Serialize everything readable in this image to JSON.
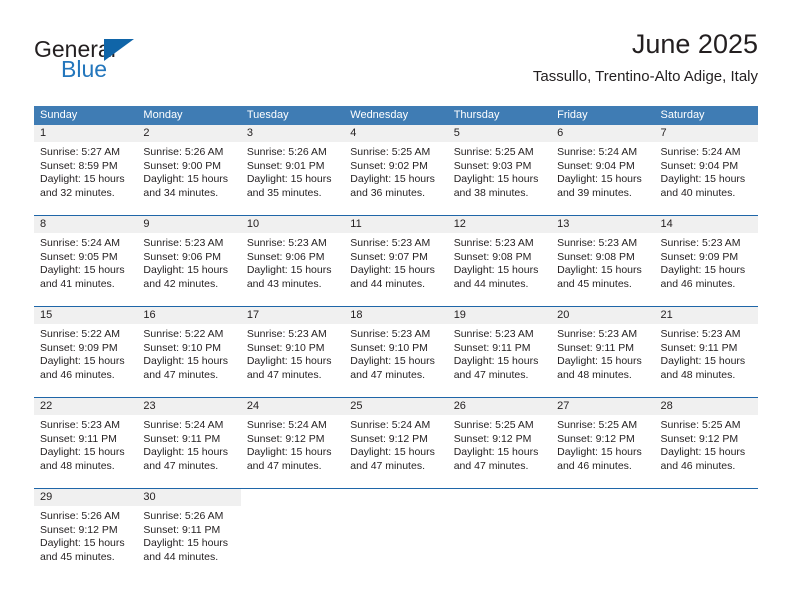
{
  "brand": {
    "name_part1": "General",
    "name_part2": "Blue"
  },
  "header": {
    "month_title": "June 2025",
    "location": "Tassullo, Trentino-Alto Adige, Italy"
  },
  "colors": {
    "header_blue": "#3f7cb4",
    "row_border_blue": "#1f66a8",
    "daynum_band": "#f0f0f0",
    "brand_blue": "#2376bc",
    "text": "#231f20"
  },
  "weekdays": [
    "Sunday",
    "Monday",
    "Tuesday",
    "Wednesday",
    "Thursday",
    "Friday",
    "Saturday"
  ],
  "weeks": [
    [
      {
        "day": "1",
        "sunrise": "Sunrise: 5:27 AM",
        "sunset": "Sunset: 8:59 PM",
        "daylight1": "Daylight: 15 hours",
        "daylight2": "and 32 minutes."
      },
      {
        "day": "2",
        "sunrise": "Sunrise: 5:26 AM",
        "sunset": "Sunset: 9:00 PM",
        "daylight1": "Daylight: 15 hours",
        "daylight2": "and 34 minutes."
      },
      {
        "day": "3",
        "sunrise": "Sunrise: 5:26 AM",
        "sunset": "Sunset: 9:01 PM",
        "daylight1": "Daylight: 15 hours",
        "daylight2": "and 35 minutes."
      },
      {
        "day": "4",
        "sunrise": "Sunrise: 5:25 AM",
        "sunset": "Sunset: 9:02 PM",
        "daylight1": "Daylight: 15 hours",
        "daylight2": "and 36 minutes."
      },
      {
        "day": "5",
        "sunrise": "Sunrise: 5:25 AM",
        "sunset": "Sunset: 9:03 PM",
        "daylight1": "Daylight: 15 hours",
        "daylight2": "and 38 minutes."
      },
      {
        "day": "6",
        "sunrise": "Sunrise: 5:24 AM",
        "sunset": "Sunset: 9:04 PM",
        "daylight1": "Daylight: 15 hours",
        "daylight2": "and 39 minutes."
      },
      {
        "day": "7",
        "sunrise": "Sunrise: 5:24 AM",
        "sunset": "Sunset: 9:04 PM",
        "daylight1": "Daylight: 15 hours",
        "daylight2": "and 40 minutes."
      }
    ],
    [
      {
        "day": "8",
        "sunrise": "Sunrise: 5:24 AM",
        "sunset": "Sunset: 9:05 PM",
        "daylight1": "Daylight: 15 hours",
        "daylight2": "and 41 minutes."
      },
      {
        "day": "9",
        "sunrise": "Sunrise: 5:23 AM",
        "sunset": "Sunset: 9:06 PM",
        "daylight1": "Daylight: 15 hours",
        "daylight2": "and 42 minutes."
      },
      {
        "day": "10",
        "sunrise": "Sunrise: 5:23 AM",
        "sunset": "Sunset: 9:06 PM",
        "daylight1": "Daylight: 15 hours",
        "daylight2": "and 43 minutes."
      },
      {
        "day": "11",
        "sunrise": "Sunrise: 5:23 AM",
        "sunset": "Sunset: 9:07 PM",
        "daylight1": "Daylight: 15 hours",
        "daylight2": "and 44 minutes."
      },
      {
        "day": "12",
        "sunrise": "Sunrise: 5:23 AM",
        "sunset": "Sunset: 9:08 PM",
        "daylight1": "Daylight: 15 hours",
        "daylight2": "and 44 minutes."
      },
      {
        "day": "13",
        "sunrise": "Sunrise: 5:23 AM",
        "sunset": "Sunset: 9:08 PM",
        "daylight1": "Daylight: 15 hours",
        "daylight2": "and 45 minutes."
      },
      {
        "day": "14",
        "sunrise": "Sunrise: 5:23 AM",
        "sunset": "Sunset: 9:09 PM",
        "daylight1": "Daylight: 15 hours",
        "daylight2": "and 46 minutes."
      }
    ],
    [
      {
        "day": "15",
        "sunrise": "Sunrise: 5:22 AM",
        "sunset": "Sunset: 9:09 PM",
        "daylight1": "Daylight: 15 hours",
        "daylight2": "and 46 minutes."
      },
      {
        "day": "16",
        "sunrise": "Sunrise: 5:22 AM",
        "sunset": "Sunset: 9:10 PM",
        "daylight1": "Daylight: 15 hours",
        "daylight2": "and 47 minutes."
      },
      {
        "day": "17",
        "sunrise": "Sunrise: 5:23 AM",
        "sunset": "Sunset: 9:10 PM",
        "daylight1": "Daylight: 15 hours",
        "daylight2": "and 47 minutes."
      },
      {
        "day": "18",
        "sunrise": "Sunrise: 5:23 AM",
        "sunset": "Sunset: 9:10 PM",
        "daylight1": "Daylight: 15 hours",
        "daylight2": "and 47 minutes."
      },
      {
        "day": "19",
        "sunrise": "Sunrise: 5:23 AM",
        "sunset": "Sunset: 9:11 PM",
        "daylight1": "Daylight: 15 hours",
        "daylight2": "and 47 minutes."
      },
      {
        "day": "20",
        "sunrise": "Sunrise: 5:23 AM",
        "sunset": "Sunset: 9:11 PM",
        "daylight1": "Daylight: 15 hours",
        "daylight2": "and 48 minutes."
      },
      {
        "day": "21",
        "sunrise": "Sunrise: 5:23 AM",
        "sunset": "Sunset: 9:11 PM",
        "daylight1": "Daylight: 15 hours",
        "daylight2": "and 48 minutes."
      }
    ],
    [
      {
        "day": "22",
        "sunrise": "Sunrise: 5:23 AM",
        "sunset": "Sunset: 9:11 PM",
        "daylight1": "Daylight: 15 hours",
        "daylight2": "and 48 minutes."
      },
      {
        "day": "23",
        "sunrise": "Sunrise: 5:24 AM",
        "sunset": "Sunset: 9:11 PM",
        "daylight1": "Daylight: 15 hours",
        "daylight2": "and 47 minutes."
      },
      {
        "day": "24",
        "sunrise": "Sunrise: 5:24 AM",
        "sunset": "Sunset: 9:12 PM",
        "daylight1": "Daylight: 15 hours",
        "daylight2": "and 47 minutes."
      },
      {
        "day": "25",
        "sunrise": "Sunrise: 5:24 AM",
        "sunset": "Sunset: 9:12 PM",
        "daylight1": "Daylight: 15 hours",
        "daylight2": "and 47 minutes."
      },
      {
        "day": "26",
        "sunrise": "Sunrise: 5:25 AM",
        "sunset": "Sunset: 9:12 PM",
        "daylight1": "Daylight: 15 hours",
        "daylight2": "and 47 minutes."
      },
      {
        "day": "27",
        "sunrise": "Sunrise: 5:25 AM",
        "sunset": "Sunset: 9:12 PM",
        "daylight1": "Daylight: 15 hours",
        "daylight2": "and 46 minutes."
      },
      {
        "day": "28",
        "sunrise": "Sunrise: 5:25 AM",
        "sunset": "Sunset: 9:12 PM",
        "daylight1": "Daylight: 15 hours",
        "daylight2": "and 46 minutes."
      }
    ],
    [
      {
        "day": "29",
        "sunrise": "Sunrise: 5:26 AM",
        "sunset": "Sunset: 9:12 PM",
        "daylight1": "Daylight: 15 hours",
        "daylight2": "and 45 minutes."
      },
      {
        "day": "30",
        "sunrise": "Sunrise: 5:26 AM",
        "sunset": "Sunset: 9:11 PM",
        "daylight1": "Daylight: 15 hours",
        "daylight2": "and 44 minutes."
      },
      {
        "day": "",
        "sunrise": "",
        "sunset": "",
        "daylight1": "",
        "daylight2": ""
      },
      {
        "day": "",
        "sunrise": "",
        "sunset": "",
        "daylight1": "",
        "daylight2": ""
      },
      {
        "day": "",
        "sunrise": "",
        "sunset": "",
        "daylight1": "",
        "daylight2": ""
      },
      {
        "day": "",
        "sunrise": "",
        "sunset": "",
        "daylight1": "",
        "daylight2": ""
      },
      {
        "day": "",
        "sunrise": "",
        "sunset": "",
        "daylight1": "",
        "daylight2": ""
      }
    ]
  ]
}
